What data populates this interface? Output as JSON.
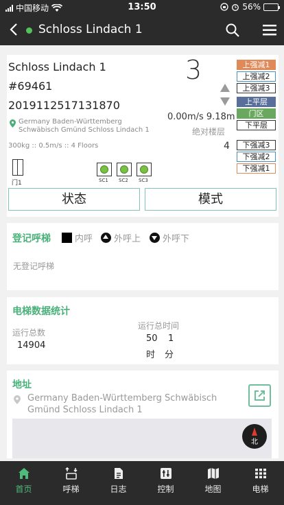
{
  "status_bar": {
    "carrier": "中国移动",
    "time": "13:50",
    "battery": "56%"
  },
  "nav": {
    "title": "Schloss Lindach 1",
    "online_color": "#54c25a"
  },
  "elevator": {
    "name": "Schloss Lindach 1",
    "id": "#69461",
    "serial": "2019112517131870",
    "location": "Germany Baden-Württemberg Schwäbisch Gmünd Schloss Lindach 1",
    "specs": "300kg :: 0.5m/s :: 4 Floors",
    "current_floor": "3",
    "speed_height": "0.00m/s 9.18m",
    "absolute_floor_label": "绝对楼层",
    "absolute_floor_value": "4",
    "door_label": "门1",
    "safety_circuits": [
      "SC1",
      "SC2",
      "SC3"
    ]
  },
  "floor_buttons_top": [
    {
      "label": "上强减1",
      "style": "orange-filled"
    },
    {
      "label": "上强减2",
      "style": "blue"
    },
    {
      "label": "上强减3",
      "style": "dark"
    },
    {
      "label": "上平层",
      "style": "slate"
    },
    {
      "label": "门区",
      "style": "green"
    },
    {
      "label": "下平层",
      "style": "dark"
    }
  ],
  "floor_buttons_bottom": [
    {
      "label": "下强减3",
      "style": "dark"
    },
    {
      "label": "下强减2",
      "style": "blue"
    },
    {
      "label": "下强减1",
      "style": "orange"
    }
  ],
  "actions": {
    "status": "状态",
    "mode": "模式"
  },
  "registered_calls": {
    "title": "登记呼梯",
    "legend_inner": "内呼",
    "legend_up": "外呼上",
    "legend_down": "外呼下",
    "empty": "无登记呼梯"
  },
  "stats": {
    "title": "电梯数据统计",
    "runs_label": "运行总数",
    "runs_value": "14904",
    "time_label": "运行总时间",
    "hours": "50",
    "minutes": "1",
    "hours_unit": "时",
    "minutes_unit": "分"
  },
  "address": {
    "title": "地址",
    "text": "Germany Baden-Württemberg Schwäbisch Gmünd Schloss Lindach 1",
    "compass": "北"
  },
  "tabs": [
    {
      "label": "首页",
      "icon": "home-icon",
      "active": true
    },
    {
      "label": "呼梯",
      "icon": "elevator-call-icon",
      "active": false
    },
    {
      "label": "日志",
      "icon": "log-icon",
      "active": false
    },
    {
      "label": "控制",
      "icon": "control-icon",
      "active": false
    },
    {
      "label": "地图",
      "icon": "map-icon",
      "active": false
    },
    {
      "label": "电梯",
      "icon": "grid-icon",
      "active": false
    }
  ],
  "colors": {
    "accent": "#49b07a",
    "bar_bg": "#2b2b2b"
  }
}
